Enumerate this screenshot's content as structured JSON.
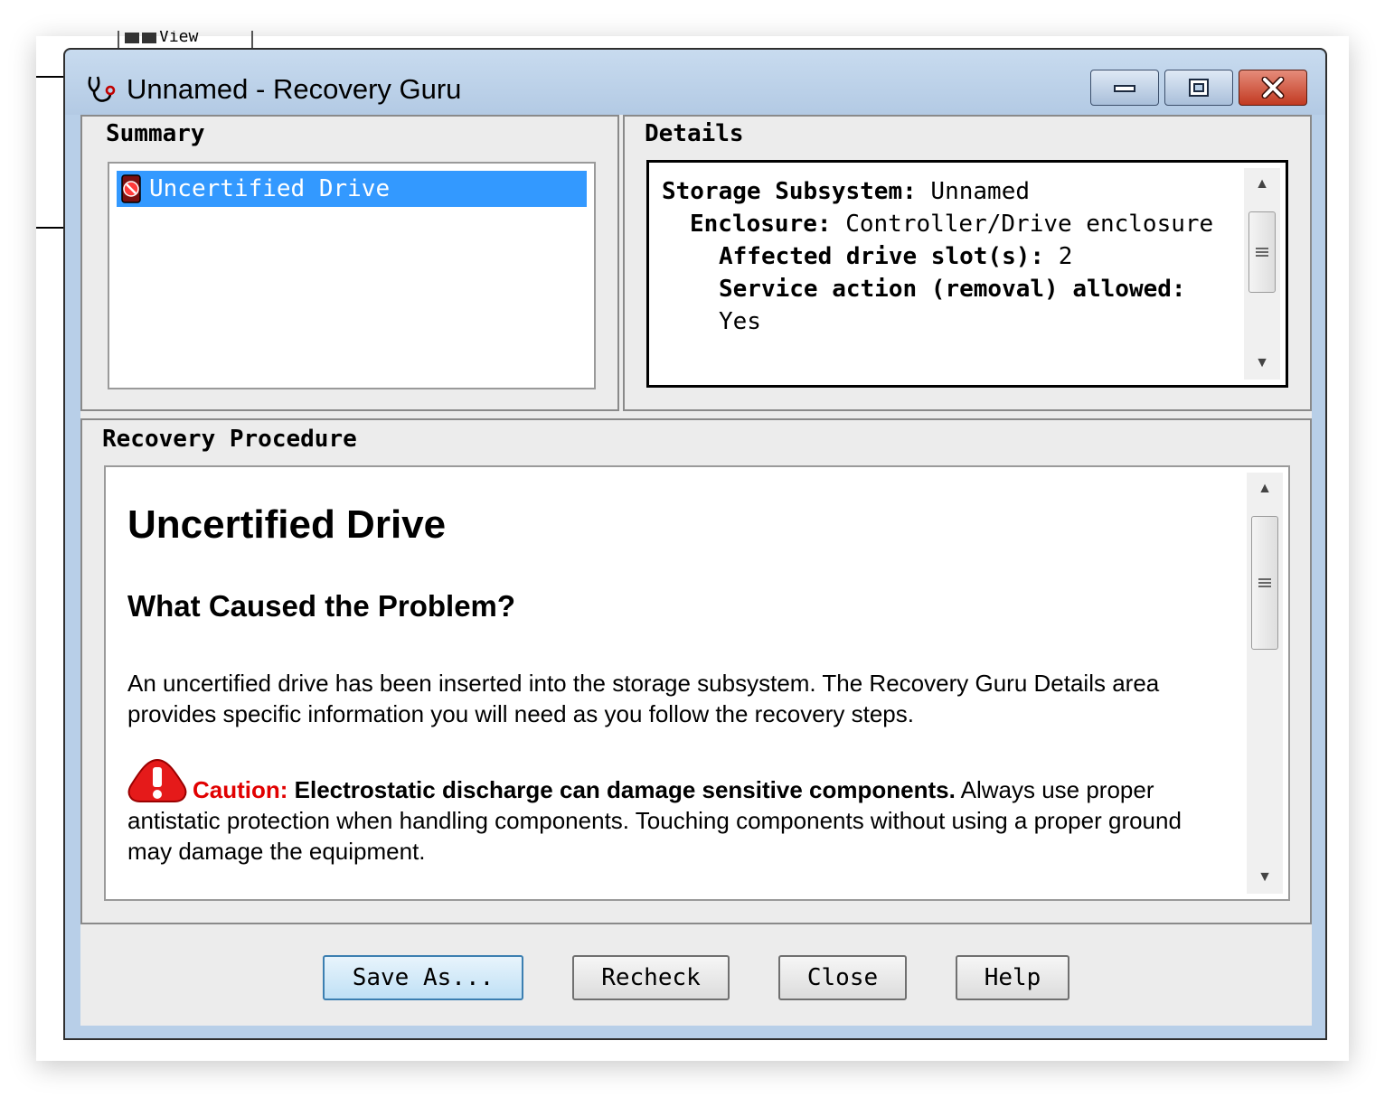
{
  "background": {
    "toolbar_text": "View"
  },
  "window": {
    "title": "Unnamed - Recovery Guru",
    "icon": "stethoscope-icon",
    "controls": [
      "minimize-icon",
      "maximize-icon",
      "close-icon"
    ]
  },
  "summary": {
    "label": "Summary",
    "items": [
      {
        "label": "Uncertified Drive",
        "icon": "drive-error-icon",
        "selected": true
      }
    ]
  },
  "details": {
    "label": "Details",
    "lines": [
      {
        "key": "Storage Subsystem:",
        "value": "Unnamed"
      },
      {
        "key": "Enclosure:",
        "value": "Controller/Drive enclosure"
      },
      {
        "key": "Affected drive slot(s):",
        "value": "2"
      },
      {
        "key": "Service action (removal) allowed:",
        "value": "Yes"
      }
    ]
  },
  "procedure": {
    "label": "Recovery Procedure",
    "title": "Uncertified Drive",
    "subtitle": "What Caused the Problem?",
    "paragraph": "An uncertified drive has been inserted into the storage subsystem. The Recovery Guru Details area provides specific information you will need as you follow the recovery steps.",
    "caution": {
      "label": "Caution:",
      "bold": "Electrostatic discharge can damage sensitive components.",
      "text": "Always use proper antistatic protection when handling components. Touching components without using a proper ground may damage the equipment.",
      "icon": "warning-icon"
    }
  },
  "buttons": {
    "save_as": "Save As...",
    "recheck": "Recheck",
    "close": "Close",
    "help": "Help"
  },
  "colors": {
    "selection": "#3399ff",
    "caution": "#e10000",
    "title_bar": "#b8cfe8",
    "close_button": "#c23a22"
  }
}
